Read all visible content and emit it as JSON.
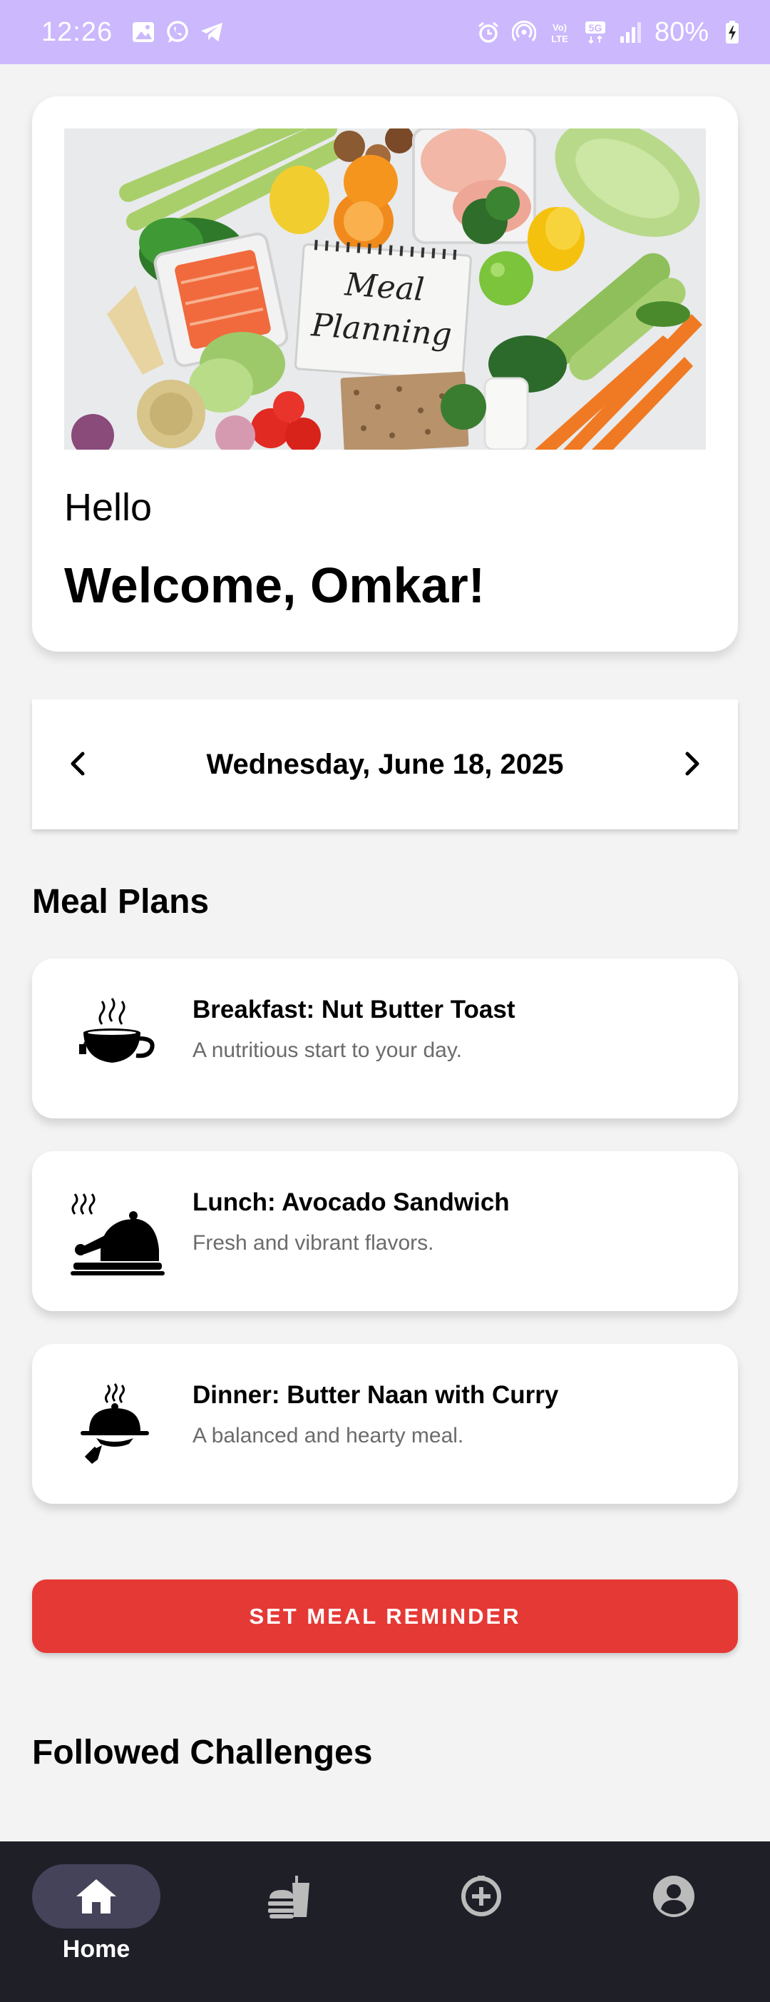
{
  "status_bar": {
    "time": "12:26",
    "battery": "80%"
  },
  "hero": {
    "image_text_line1": "Meal",
    "image_text_line2": "Planning",
    "greeting": "Hello",
    "welcome": "Welcome, Omkar!"
  },
  "date_nav": {
    "date": "Wednesday, June 18, 2025"
  },
  "meal_plans": {
    "title": "Meal Plans",
    "items": [
      {
        "title": "Breakfast: Nut Butter Toast",
        "desc": "A nutritious start to your day.",
        "icon": "tea-cup-icon"
      },
      {
        "title": "Lunch: Avocado Sandwich",
        "desc": "Fresh and vibrant flavors.",
        "icon": "roast-chicken-icon"
      },
      {
        "title": "Dinner: Butter Naan with Curry",
        "desc": "A balanced and hearty meal.",
        "icon": "serving-cloche-icon"
      }
    ]
  },
  "reminder_button": "SET MEAL REMINDER",
  "challenges": {
    "title": "Followed Challenges"
  },
  "bottom_nav": {
    "items": [
      {
        "label": "Home",
        "icon": "home-icon",
        "active": true
      },
      {
        "label": "",
        "icon": "fast-food-icon",
        "active": false
      },
      {
        "label": "",
        "icon": "add-circle-icon",
        "active": false
      },
      {
        "label": "",
        "icon": "account-icon",
        "active": false
      }
    ]
  },
  "colors": {
    "status_bar": "#cbb8fd",
    "reminder_button": "#e53935",
    "nav_background": "#1f1f28",
    "nav_active_pill": "#45435a"
  }
}
